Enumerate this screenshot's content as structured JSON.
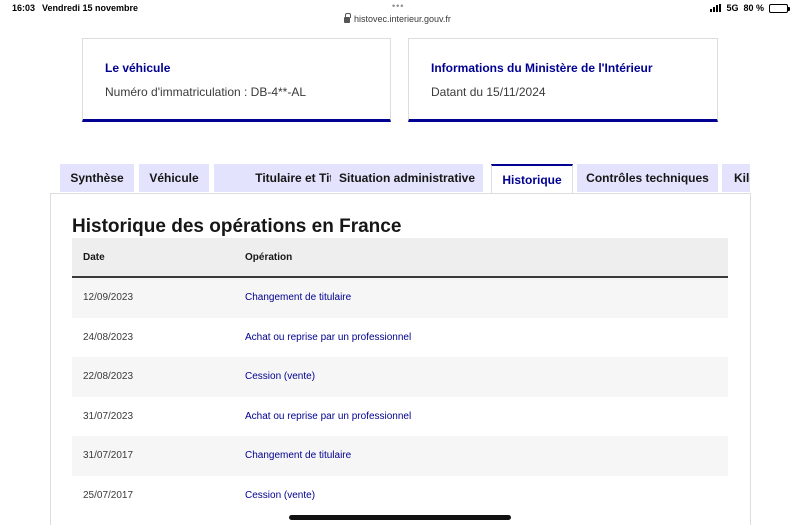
{
  "statusbar": {
    "time": "16:03",
    "date": "Vendredi 15 novembre",
    "url": "histovec.interieur.gouv.fr",
    "network": "5G",
    "battery_label": "80 %",
    "battery_level": 0.8
  },
  "cards": [
    {
      "title": "Le véhicule",
      "text": "Numéro d'immatriculation : DB-4**-AL"
    },
    {
      "title": "Informations du Ministère de l'Intérieur",
      "text": "Datant du 15/11/2024"
    }
  ],
  "tabs": [
    {
      "label": "Synthèse",
      "active": false
    },
    {
      "label": "Véhicule",
      "active": false
    },
    {
      "label": "Titulaire et Titre",
      "active": false
    },
    {
      "label": "Situation administrative",
      "active": false
    },
    {
      "label": "Historique",
      "active": true
    },
    {
      "label": "Contrôles techniques",
      "active": false
    },
    {
      "label": "Kilo",
      "active": false
    }
  ],
  "history": {
    "title": "Historique des opérations en France",
    "columns": {
      "date": "Date",
      "operation": "Opération"
    },
    "rows": [
      {
        "date": "12/09/2023",
        "operation": "Changement de titulaire"
      },
      {
        "date": "24/08/2023",
        "operation": "Achat ou reprise par un professionnel"
      },
      {
        "date": "22/08/2023",
        "operation": "Cession (vente)"
      },
      {
        "date": "31/07/2023",
        "operation": "Achat ou reprise par un professionnel"
      },
      {
        "date": "31/07/2017",
        "operation": "Changement de titulaire"
      },
      {
        "date": "25/07/2017",
        "operation": "Cession (vente)"
      }
    ]
  },
  "colors": {
    "accent": "#000091",
    "tab_inactive": "#e3e3fd",
    "row_alt": "#f6f6f6"
  }
}
